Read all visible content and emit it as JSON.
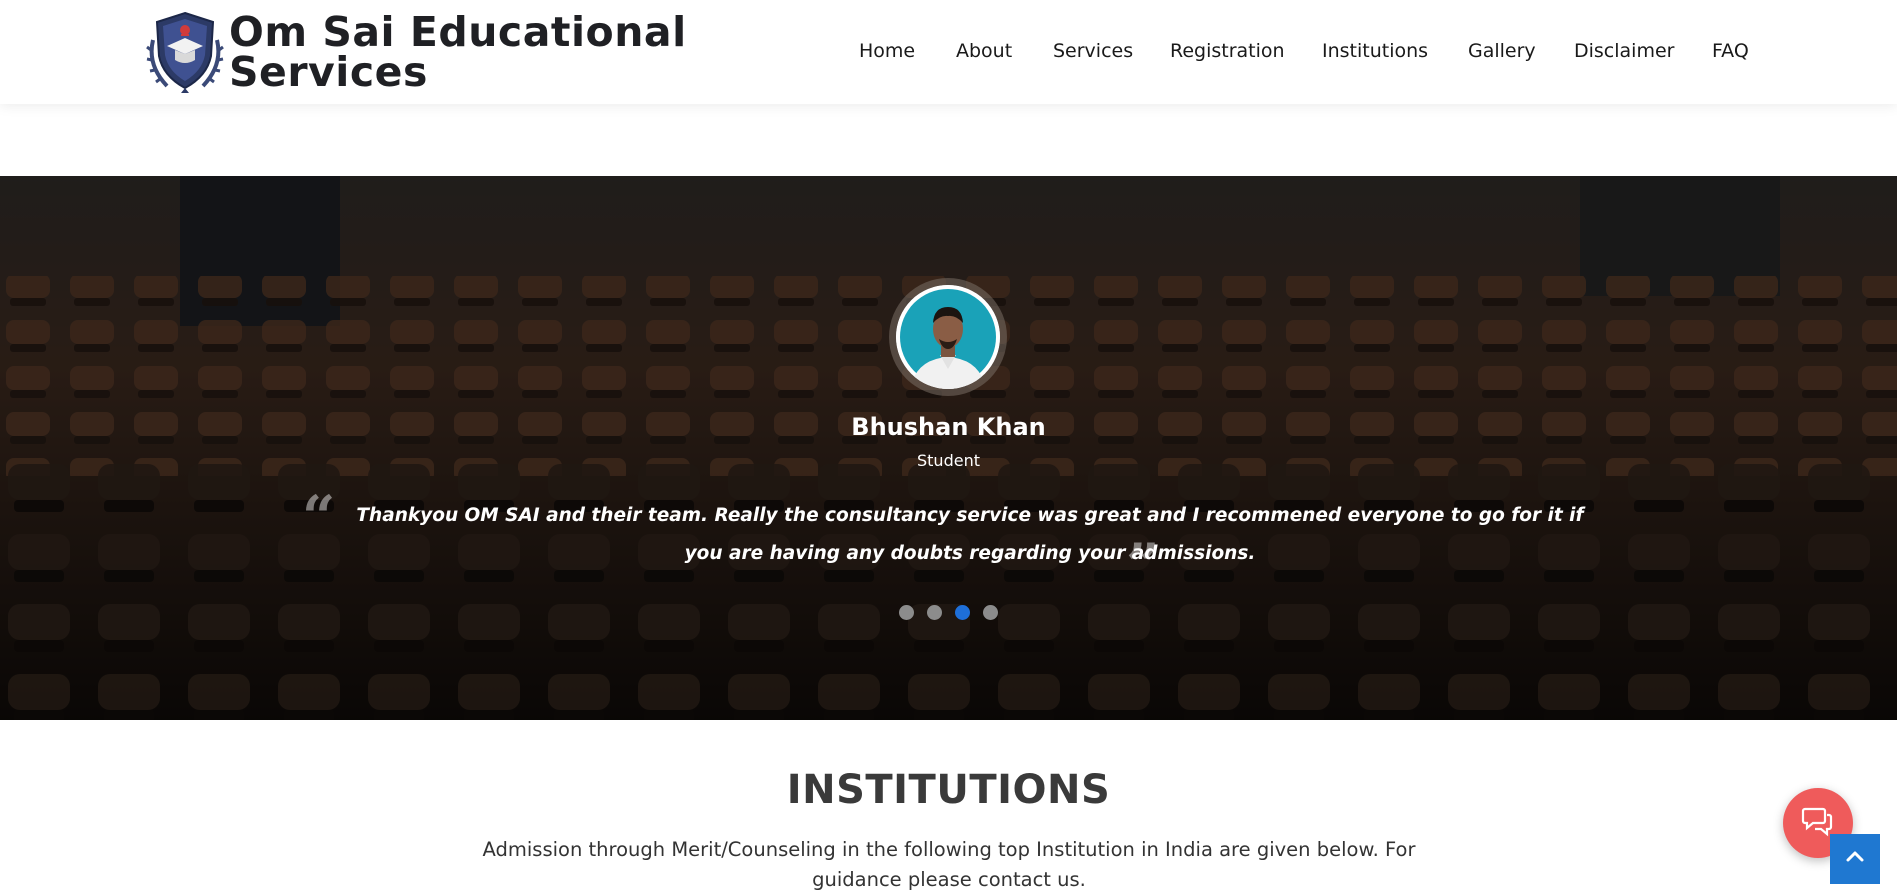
{
  "header": {
    "brand_line1": "Om Sai Educational",
    "brand_line2": "Services",
    "nav": [
      "Home",
      "About",
      "Services",
      "Registration",
      "Institutions",
      "Gallery",
      "Disclaimer",
      "FAQ"
    ]
  },
  "testimonial": {
    "name": "Bhushan Khan",
    "role": "Student",
    "quote": "Thankyou OM SAI and their team. Really the consultancy service was great and I recommened everyone to go for it if you are having any doubts regarding your admissions.",
    "open_quote_mark": "“",
    "close_quote_mark": "”",
    "slides_total": 4,
    "active_slide": 3
  },
  "institutions": {
    "title": "INSTITUTIONS",
    "description": "Admission through Merit/Counseling in the following top Institution in India are given below. For guidance please contact us."
  },
  "colors": {
    "accent_blue": "#1e6fd9",
    "chat_button": "#ef5b5b",
    "scroll_top_button": "#1f78d1"
  },
  "icons": {
    "chat": "chat-bubbles-icon",
    "scroll_top": "chevron-up-icon"
  }
}
